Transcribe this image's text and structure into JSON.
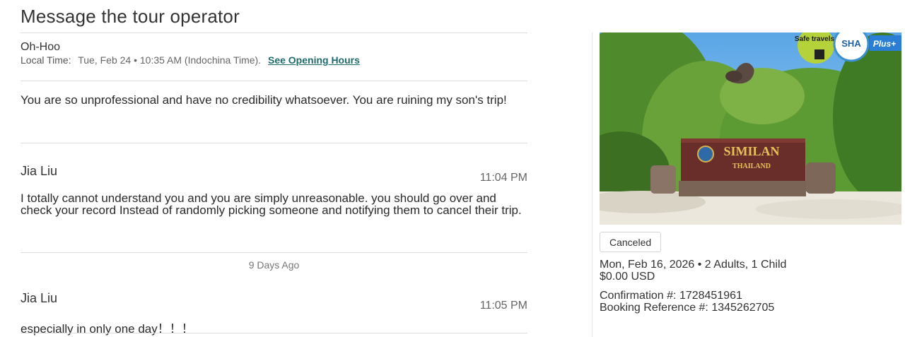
{
  "page": {
    "title": "Message the tour operator"
  },
  "operator": {
    "name": "Oh-Hoo",
    "local_time_label": "Local Time:",
    "local_time_value": "Tue, Feb 24 • 10:35 AM (Indochina Time).",
    "opening_hours_link": "See Opening Hours"
  },
  "messages": [
    {
      "text": "You are so unprofessional and have no credibility whatsoever. You are ruining my son's trip!"
    },
    {
      "sender": "Jia Liu",
      "time": "11:04 PM",
      "text_line1": "I totally cannot understand you and you are simply unreasonable. you should go over and",
      "text_line2": "check your record Instead of randomly picking someone and notifying them to cancel their trip."
    },
    {
      "sender": "Jia Liu",
      "time": "11:05 PM",
      "text": "especially in only one day！！！"
    }
  ],
  "separator": {
    "days_ago": "9 Days Ago"
  },
  "booking": {
    "image_badges": {
      "safe_travels": "Safe travels",
      "sha": "SHA",
      "plus": "Plus+"
    },
    "sign_text_1": "SIMILAN",
    "sign_text_2": "THAILAND",
    "status": "Canceled",
    "date_guests": "Mon, Feb 16, 2026 • 2 Adults, 1 Child",
    "price": "$0.00 USD",
    "confirmation": "Confirmation #: 1728451961",
    "booking_reference": "Booking Reference #: 1345262705"
  }
}
